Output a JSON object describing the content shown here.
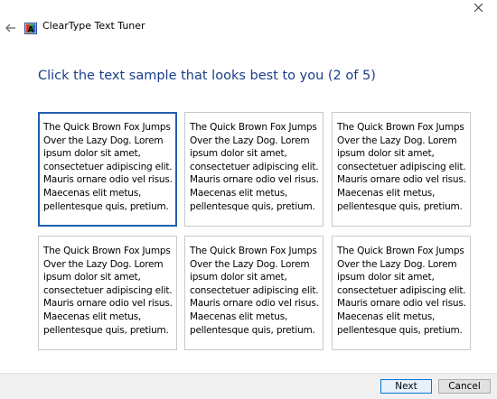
{
  "window": {
    "title": "ClearType Text Tuner",
    "close_glyph": "✕",
    "back_glyph": "←"
  },
  "heading": "Click the text sample that looks best to you (2 of 5)",
  "samples": [
    {
      "text": "The Quick Brown Fox Jumps\nOver the Lazy Dog. Lorem\nipsum dolor sit amet,\nconsectetuer adipiscing elit.\nMauris ornare odio vel risus.\nMaecenas elit metus,\npellentesque quis, pretium.",
      "selected": true
    },
    {
      "text": "The Quick Brown Fox Jumps\nOver the Lazy Dog. Lorem\nipsum dolor sit amet,\nconsectetuer adipiscing elit.\nMauris ornare odio vel risus.\nMaecenas elit metus,\npellentesque quis, pretium.",
      "selected": false
    },
    {
      "text": "The Quick Brown Fox Jumps\nOver the Lazy Dog. Lorem\nipsum dolor sit amet,\nconsectetuer adipiscing elit.\nMauris ornare odio vel risus.\nMaecenas elit metus,\npellentesque quis, pretium.",
      "selected": false
    },
    {
      "text": "The Quick Brown Fox Jumps\nOver the Lazy Dog. Lorem\nipsum dolor sit amet,\nconsectetuer adipiscing elit.\nMauris ornare odio vel risus.\nMaecenas elit metus,\npellentesque quis, pretium.",
      "selected": false
    },
    {
      "text": "The Quick Brown Fox Jumps\nOver the Lazy Dog. Lorem\nipsum dolor sit amet,\nconsectetuer adipiscing elit.\nMauris ornare odio vel risus.\nMaecenas elit metus,\npellentesque quis, pretium.",
      "selected": false
    },
    {
      "text": "The Quick Brown Fox Jumps\nOver the Lazy Dog. Lorem\nipsum dolor sit amet,\nconsectetuer adipiscing elit.\nMauris ornare odio vel risus.\nMaecenas elit metus,\npellentesque quis, pretium.",
      "selected": false
    }
  ],
  "footer": {
    "next_label": "Next",
    "cancel_label": "Cancel"
  },
  "colors": {
    "heading": "#1a3e8a",
    "selected_border": "#1f5fb0",
    "sample_border": "#c9c9c9",
    "footer_bg": "#f0f0f0"
  },
  "icons": {
    "app": "cleartype-icon",
    "back": "back-arrow-icon",
    "close": "close-icon"
  }
}
